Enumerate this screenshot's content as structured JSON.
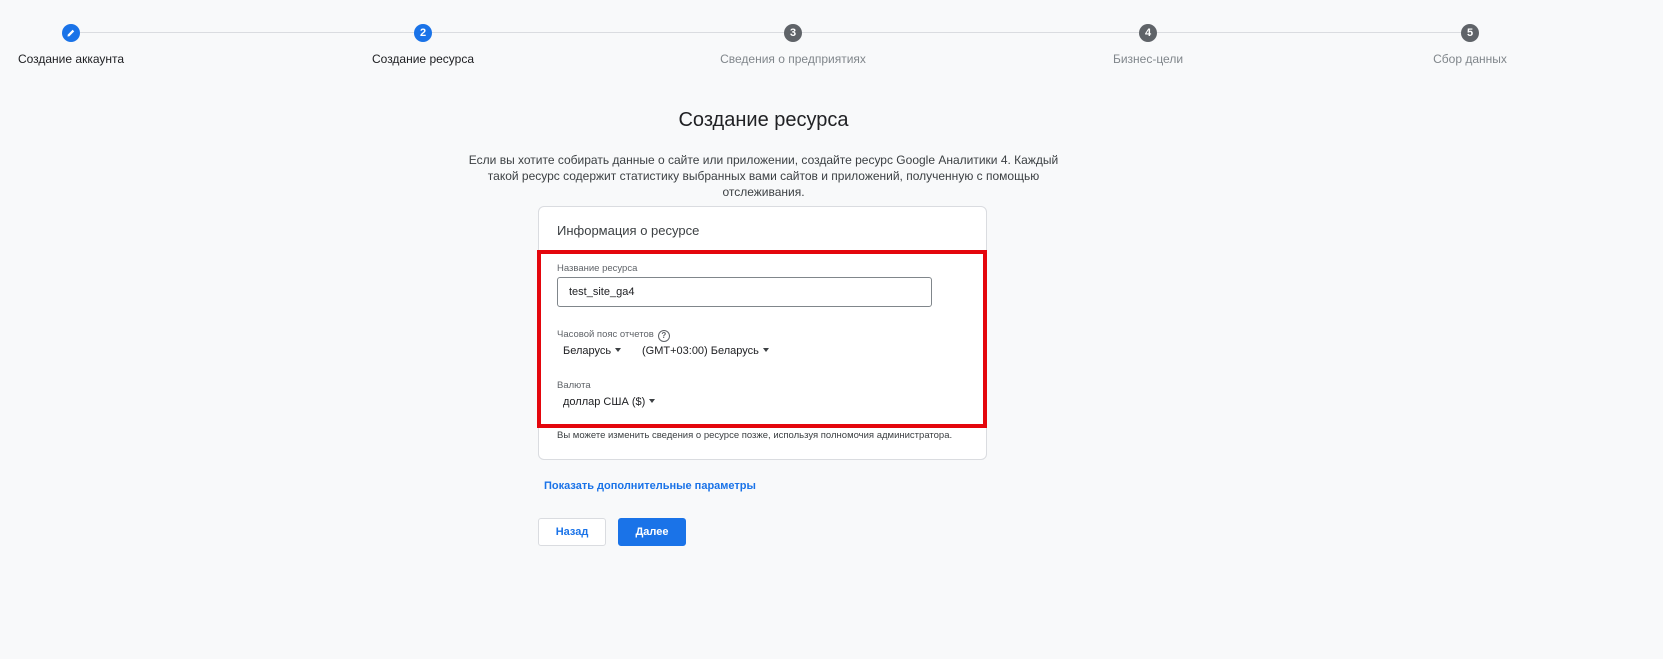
{
  "stepper": {
    "steps": [
      {
        "number": "",
        "label": "Создание аккаунта",
        "state": "done",
        "icon": "pencil-icon"
      },
      {
        "number": "2",
        "label": "Создание ресурса",
        "state": "current"
      },
      {
        "number": "3",
        "label": "Сведения о предприятиях",
        "state": "upcoming"
      },
      {
        "number": "4",
        "label": "Бизнес-цели",
        "state": "upcoming"
      },
      {
        "number": "5",
        "label": "Сбор данных",
        "state": "upcoming"
      }
    ]
  },
  "main": {
    "title": "Создание ресурса",
    "description": "Если вы хотите собирать данные о сайте или приложении, создайте ресурс Google Аналитики 4. Каждый такой ресурс содержит статистику выбранных вами сайтов и приложений, полученную с помощью отслеживания."
  },
  "card": {
    "title": "Информация о ресурсе",
    "property_name_label": "Название ресурса",
    "property_name_value": "test_site_ga4",
    "timezone_label": "Часовой пояс отчетов",
    "timezone_help": "?",
    "country_value": "Беларусь",
    "timezone_value": "(GMT+03:00) Беларусь",
    "currency_label": "Валюта",
    "currency_value": "доллар США ($)",
    "note": "Вы можете изменить сведения о ресурсе позже, используя полномочия администратора."
  },
  "links": {
    "more_options": "Показать дополнительные параметры"
  },
  "buttons": {
    "back": "Назад",
    "next": "Далее"
  },
  "colors": {
    "accent": "#1a73e8",
    "highlight": "#e4060d",
    "inactive_step": "#5f6368"
  }
}
